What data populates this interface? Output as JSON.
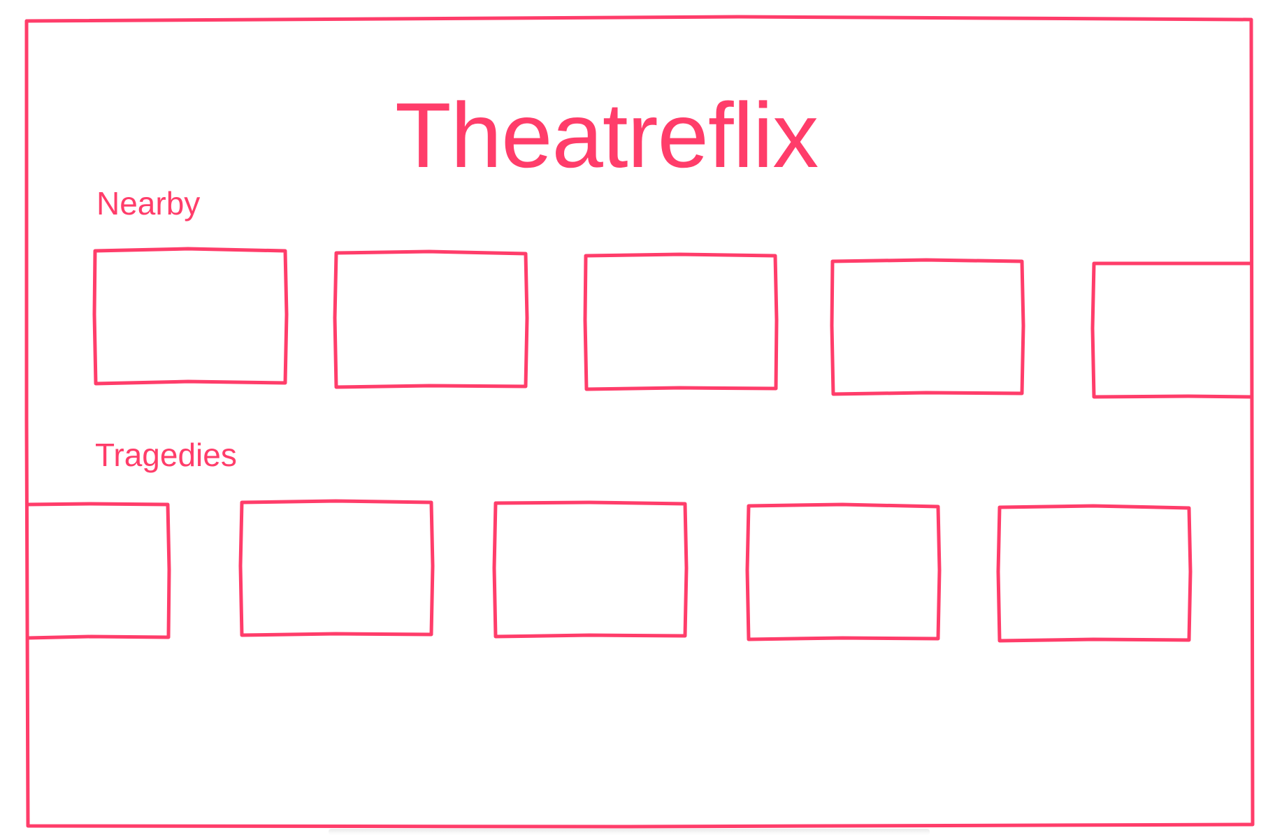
{
  "app": {
    "title": "Theatreflix",
    "accent_color": "#ff3d6a"
  },
  "sections": [
    {
      "label": "Nearby",
      "card_count": 5
    },
    {
      "label": "Tragedies",
      "card_count": 5
    }
  ]
}
